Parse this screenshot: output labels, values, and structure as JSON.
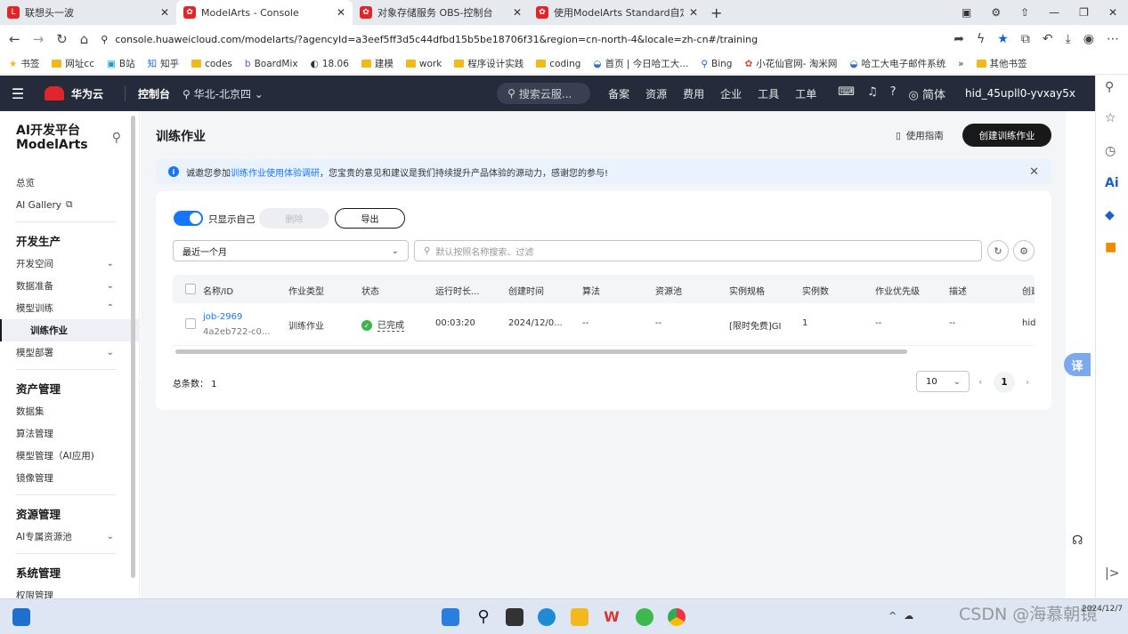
{
  "browser": {
    "tabs": [
      {
        "label": "联想头一波",
        "icon": "lenovo"
      },
      {
        "label": "ModelArts - Console",
        "icon": "huawei"
      },
      {
        "label": "对象存储服务 OBS-控制台",
        "icon": "huawei"
      },
      {
        "label": "使用ModelArts Standard自定义",
        "icon": "huawei"
      }
    ],
    "url": "console.huaweicloud.com/modelarts/?agencyId=a3eef5ff3d5c44dfbd15b5be18706f31&region=cn-north-4&locale=zh-cn#/training",
    "bookmarks": [
      "书签",
      "网址cc",
      "B站",
      "知乎",
      "codes",
      "BoardMix",
      "18.06",
      "建模",
      "work",
      "程序设计实践",
      "coding",
      "首页 | 今日哈工大...",
      "Bing",
      "小花仙官网- 淘米网",
      "哈工大电子邮件系统"
    ],
    "other_bookmarks": "其他书签"
  },
  "topbar": {
    "brand": "华为云",
    "console": "控制台",
    "region": "华北-北京四",
    "search_placeholder": "搜索云服...",
    "nav": [
      "备案",
      "资源",
      "费用",
      "企业",
      "工具",
      "工单"
    ],
    "lang": "简体",
    "user": "hid_45upll0-yvxay5x"
  },
  "sidebar": {
    "title1": "AI开发平台",
    "title2": "ModelArts",
    "items1": [
      "总览",
      "AI Gallery"
    ],
    "sec1": "开发生产",
    "dev": [
      "开发空间",
      "数据准备",
      "模型训练"
    ],
    "active": "训练作业",
    "deploy": "模型部署",
    "sec2": "资产管理",
    "assets": [
      "数据集",
      "算法管理",
      "模型管理（AI应用)",
      "镜像管理"
    ],
    "sec3": "资源管理",
    "res": "AI专属资源池",
    "sec4": "系统管理",
    "sys": "权限管理"
  },
  "page": {
    "title": "训练作业",
    "guide": "使用指南",
    "create": "创建训练作业",
    "notice_pre": "诚邀您参加",
    "notice_link": "训练作业使用体验调研",
    "notice_post": "，您宝贵的意见和建议是我们持续提升产品体验的源动力，感谢您的参与!",
    "only_mine": "只显示自己",
    "delete": "删除",
    "export": "导出",
    "range": "最近一个月",
    "search_placeholder": "默认按照名称搜索、过滤",
    "columns": [
      "名称/ID",
      "作业类型",
      "状态",
      "运行时长...",
      "创建时间",
      "算法",
      "资源池",
      "实例规格",
      "实例数",
      "作业优先级",
      "描述",
      "创建"
    ],
    "row": {
      "name": "job-2969",
      "id": "4a2eb722-c0...",
      "type": "训练作业",
      "status": "已完成",
      "duration": "00:03:20",
      "created": "2024/12/0...",
      "algo": "--",
      "pool": "--",
      "spec": "[限时免费]GI",
      "count": "1",
      "priority": "--",
      "desc": "--",
      "creator": "hid"
    },
    "total": "总条数： 1",
    "page_size": "10",
    "current_page": "1"
  },
  "taskbar": {
    "time": "",
    "date": "2024/12/7"
  },
  "watermark": "CSDN @海慕朝镜",
  "colors": {
    "topbar": "#252b3a",
    "primary": "#1476ff",
    "success": "#3db54b",
    "brand_red": "#e0252b"
  }
}
